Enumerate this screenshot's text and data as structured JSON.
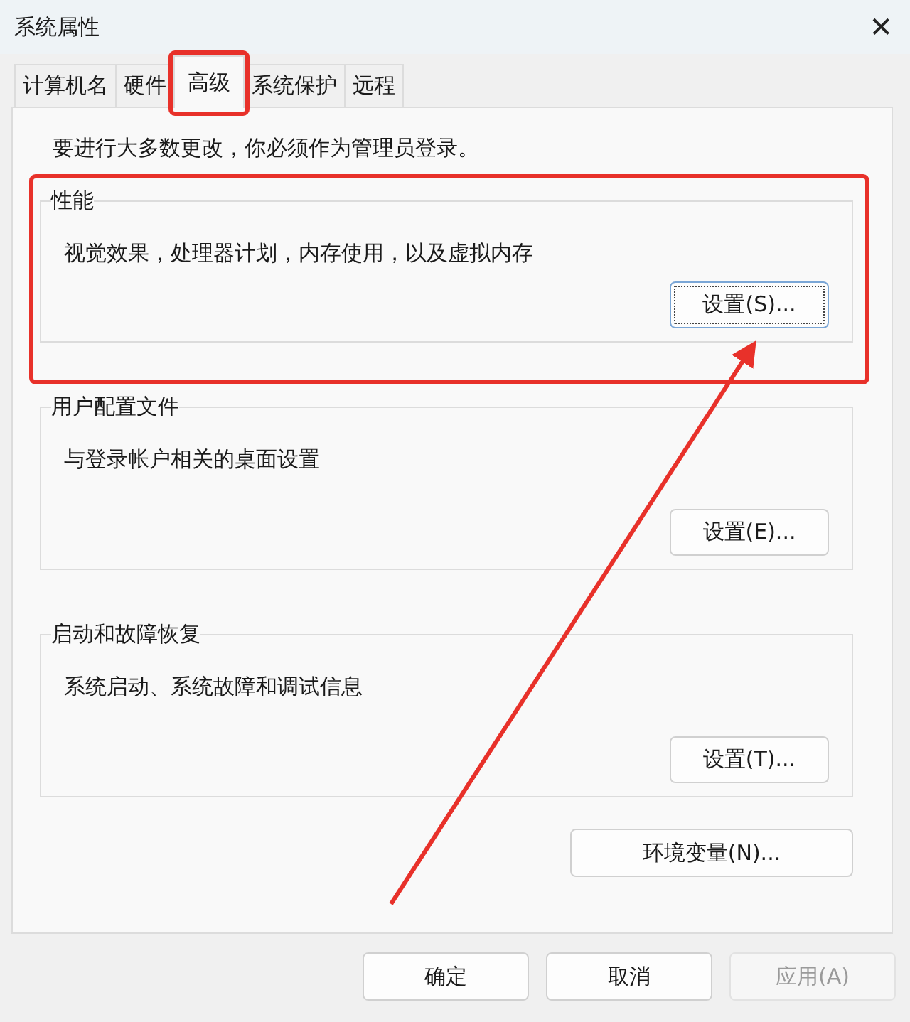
{
  "window": {
    "title": "系统属性",
    "close": "✕"
  },
  "tabs": [
    {
      "label": "计算机名",
      "selected": false,
      "highlighted": false
    },
    {
      "label": "硬件",
      "selected": false,
      "highlighted": false
    },
    {
      "label": "高级",
      "selected": true,
      "highlighted": true
    },
    {
      "label": "系统保护",
      "selected": false,
      "highlighted": false
    },
    {
      "label": "远程",
      "selected": false,
      "highlighted": false
    }
  ],
  "notice": "要进行大多数更改，你必须作为管理员登录。",
  "groups": [
    {
      "title": "性能",
      "description": "视觉效果，处理器计划，内存使用，以及虚拟内存",
      "button": "设置(S)...",
      "highlighted": true,
      "focused": true
    },
    {
      "title": "用户配置文件",
      "description": "与登录帐户相关的桌面设置",
      "button": "设置(E)...",
      "highlighted": false,
      "focused": false
    },
    {
      "title": "启动和故障恢复",
      "description": "系统启动、系统故障和调试信息",
      "button": "设置(T)...",
      "highlighted": false,
      "focused": false
    }
  ],
  "env_button": "环境变量(N)...",
  "dialog_buttons": [
    {
      "label": "确定",
      "disabled": false
    },
    {
      "label": "取消",
      "disabled": false
    },
    {
      "label": "应用(A)",
      "disabled": true
    }
  ]
}
